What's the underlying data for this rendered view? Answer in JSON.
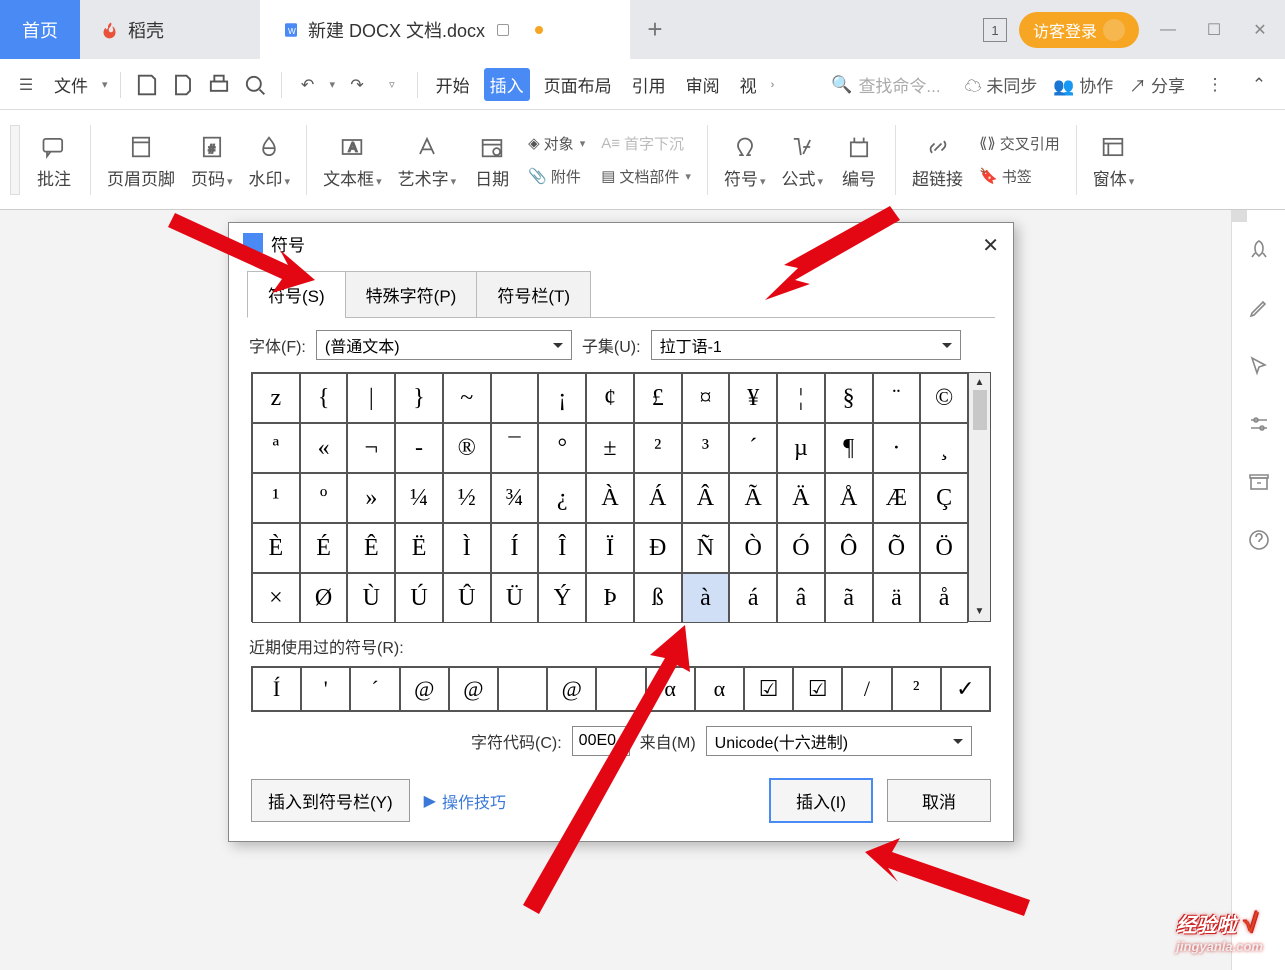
{
  "titlebar": {
    "home": "首页",
    "doke": "稻壳",
    "doc": "新建 DOCX 文档.docx",
    "login": "访客登录"
  },
  "toolbar": {
    "file": "文件",
    "menu": {
      "start": "开始",
      "insert": "插入",
      "layout": "页面布局",
      "ref": "引用",
      "review": "审阅",
      "view": "视"
    },
    "search_ph": "查找命令...",
    "unsync": "未同步",
    "collab": "协作",
    "share": "分享"
  },
  "ribbon": {
    "comment": "批注",
    "header": "页眉页脚",
    "pageno": "页码",
    "watermark": "水印",
    "textbox": "文本框",
    "wordart": "艺术字",
    "date": "日期",
    "obj": "对象",
    "dropcap": "首字下沉",
    "attach": "附件",
    "docpart": "文档部件",
    "symbol": "符号",
    "formula": "公式",
    "numbering": "编号",
    "hyperlink": "超链接",
    "crossref": "交叉引用",
    "bookmark": "书签",
    "windows": "窗体"
  },
  "dialog": {
    "title": "符号",
    "tabs": {
      "sym": "符号(S)",
      "special": "特殊字符(P)",
      "bar": "符号栏(T)"
    },
    "font_l": "字体(F):",
    "font_v": "(普通文本)",
    "subset_l": "子集(U):",
    "subset_v": "拉丁语-1",
    "recent_l": "近期使用过的符号(R):",
    "code_l": "字符代码(C):",
    "code_v": "00E0",
    "from_l": "来自(M)",
    "from_v": "Unicode(十六进制)",
    "tobar": "插入到符号栏(Y)",
    "tips": "操作技巧",
    "insert": "插入(I)",
    "cancel": "取消",
    "grid": [
      "z",
      "{",
      "|",
      "}",
      "~",
      "",
      "¡",
      "¢",
      "£",
      "¤",
      "¥",
      "¦",
      "§",
      "¨",
      "©",
      "ª",
      "«",
      "¬",
      "-",
      "®",
      "¯",
      "°",
      "±",
      "²",
      "³",
      "´",
      "µ",
      "¶",
      "·",
      "¸",
      "¹",
      "º",
      "»",
      "¼",
      "½",
      "¾",
      "¿",
      "À",
      "Á",
      "Â",
      "Ã",
      "Ä",
      "Å",
      "Æ",
      "Ç",
      "È",
      "É",
      "Ê",
      "Ë",
      "Ì",
      "Í",
      "Î",
      "Ï",
      "Ð",
      "Ñ",
      "Ò",
      "Ó",
      "Ô",
      "Õ",
      "Ö",
      "×",
      "Ø",
      "Ù",
      "Ú",
      "Û",
      "Ü",
      "Ý",
      "Þ",
      "ß",
      "à",
      "á",
      "â",
      "ã",
      "ä",
      "å"
    ],
    "recent": [
      "Í",
      "'",
      "´",
      "@",
      "@",
      "",
      "@",
      "",
      "α",
      "α",
      "☑",
      "☑",
      "/",
      "²",
      "✓"
    ],
    "selected_index": 69
  },
  "watermark": {
    "brand": "经验啦",
    "check": "√",
    "url": "jingyanla.com"
  }
}
